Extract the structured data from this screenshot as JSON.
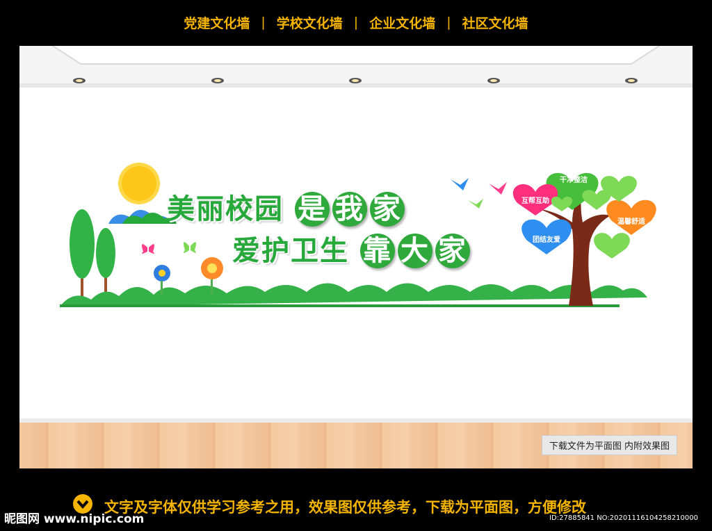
{
  "nav": {
    "items": [
      "党建文化墙",
      "学校文化墙",
      "企业文化墙",
      "社区文化墙"
    ],
    "separator": "|"
  },
  "title": {
    "line1_plain": "美丽校园",
    "line1_circles": [
      "是",
      "我",
      "家"
    ],
    "line2_plain": "爱护卫生",
    "line2_circles": [
      "靠",
      "大",
      "家"
    ]
  },
  "hearts": {
    "h1": "干净整洁",
    "h2": "互帮互助",
    "h3": "温馨舒适",
    "h4": "团结友爱"
  },
  "note": "下载文件为平面图  内附效果图",
  "footer": {
    "disclaimer": "文字及字体仅供学习参考之用，效果图仅供参考，下载为平面图，方便修改",
    "logo": "昵图网 www.nipic.com",
    "id": "ID:27885841 NO:20201116104258210000"
  },
  "colors": {
    "green": "#2fa83c",
    "accent_yellow": "#f5b400",
    "trunk": "#7b2a18"
  }
}
